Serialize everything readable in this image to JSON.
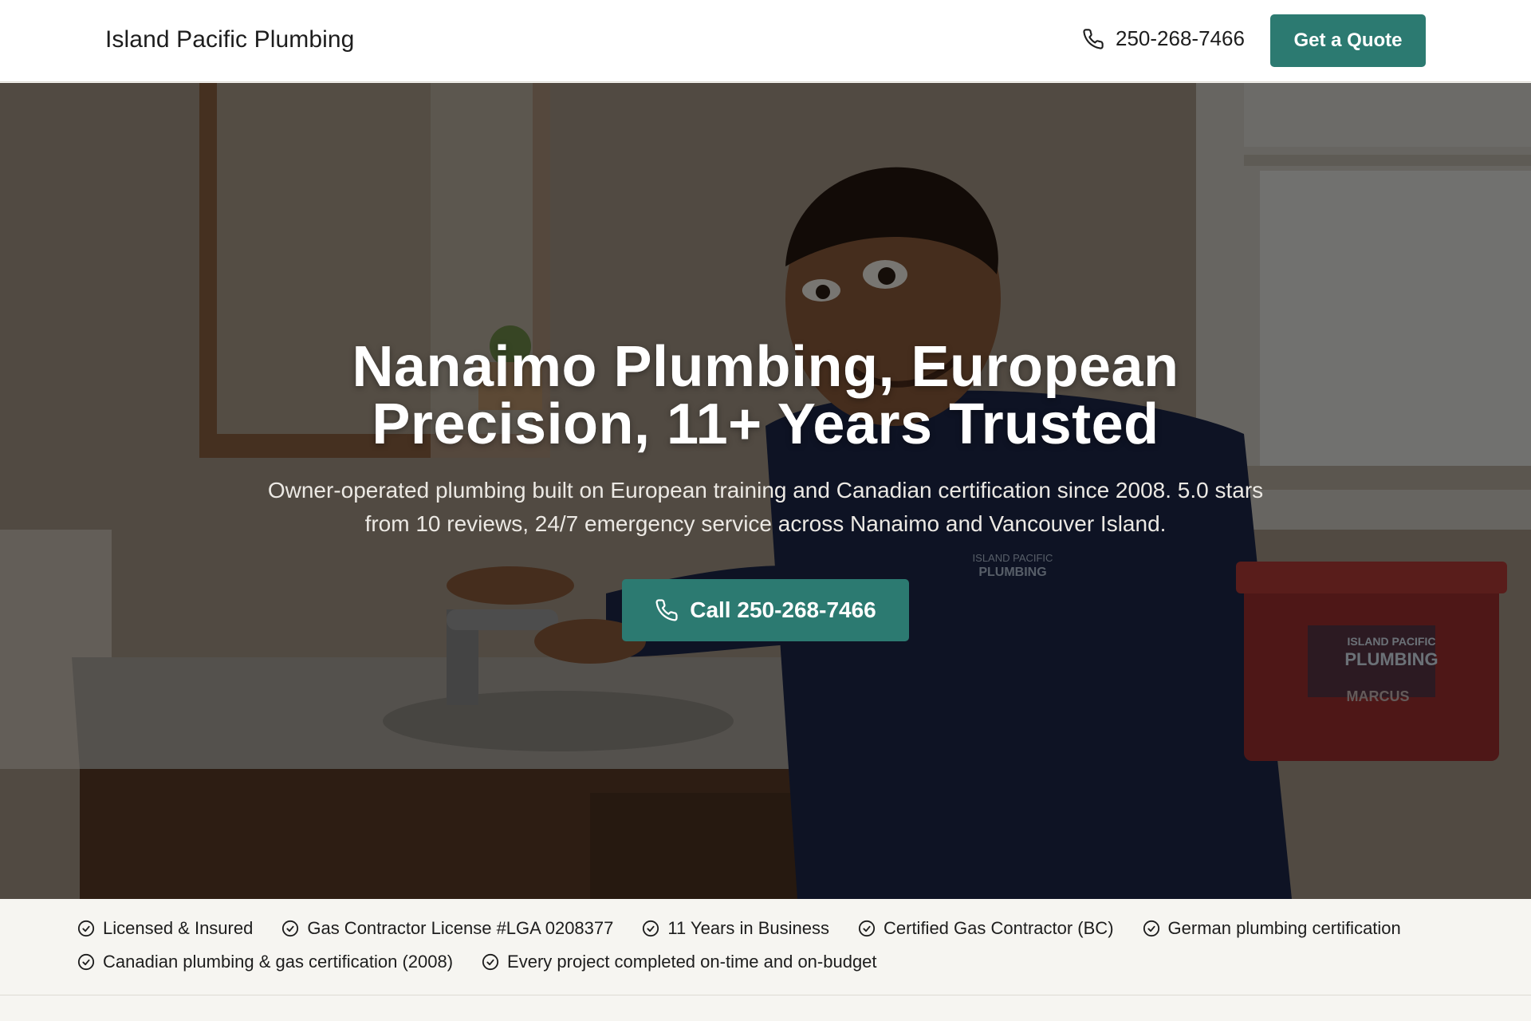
{
  "header": {
    "brand": "Island Pacific Plumbing",
    "phone": "250-268-7466",
    "quote_label": "Get a Quote"
  },
  "hero": {
    "title": "Nanaimo Plumbing, European Precision, 11+ Years Trusted",
    "subtitle": "Owner-operated plumbing built on European training and Canadian certification since 2008. 5.0 stars from 10 reviews, 24/7 emergency service across Nanaimo and Vancouver Island.",
    "call_label": "Call 250-268-7466",
    "toolbox_logo_line1": "ISLAND PACIFIC",
    "toolbox_logo_line2": "PLUMBING",
    "toolbox_name": "MARCUS",
    "shirt_logo_line1": "ISLAND PACIFIC",
    "shirt_logo_line2": "PLUMBING"
  },
  "trust": {
    "row1": [
      "Licensed & Insured",
      "Gas Contractor License #LGA 0208377",
      "11 Years in Business",
      "Certified Gas Contractor (BC)",
      "German plumbing certification"
    ],
    "row2": [
      "Canadian plumbing & gas certification (2008)",
      "Every project completed on-time and on-budget"
    ]
  },
  "colors": {
    "accent": "#2c7a71",
    "header_bg": "#ffffff",
    "trust_bg": "#f6f5f1"
  },
  "icons": {
    "phone": "phone-icon",
    "check": "check-circle-icon"
  }
}
